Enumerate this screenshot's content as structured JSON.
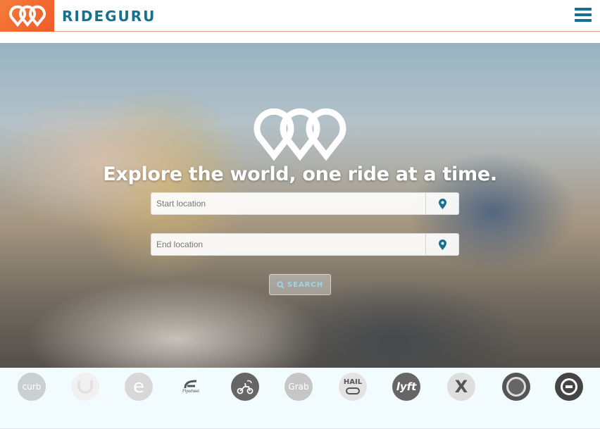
{
  "header": {
    "brand": "RIDEGURU",
    "logo_icon": "rideguru-logo-icon",
    "menu_icon": "hamburger-menu-icon",
    "colors": {
      "logo_bg": "#f15a29",
      "brand": "#17708f"
    }
  },
  "hero": {
    "headline": "Explore the world, one ride at a time.",
    "start_placeholder": "Start location",
    "end_placeholder": "End location",
    "pin_icon": "map-pin-icon",
    "search_label": "SEARCH",
    "search_icon": "search-icon"
  },
  "providers": [
    {
      "name": "Curb",
      "label": "curb"
    },
    {
      "name": "Didi",
      "label": ""
    },
    {
      "name": "eCab",
      "label": "e"
    },
    {
      "name": "Flywheel",
      "label": "Flywheel"
    },
    {
      "name": "GoJek",
      "label": ""
    },
    {
      "name": "Grab",
      "label": "Grab"
    },
    {
      "name": "Hail",
      "label": "HAIL"
    },
    {
      "name": "Lyft",
      "label": "lyft"
    },
    {
      "name": "Taxify",
      "label": "X"
    },
    {
      "name": "Via",
      "label": ""
    },
    {
      "name": "Uber",
      "label": ""
    }
  ]
}
